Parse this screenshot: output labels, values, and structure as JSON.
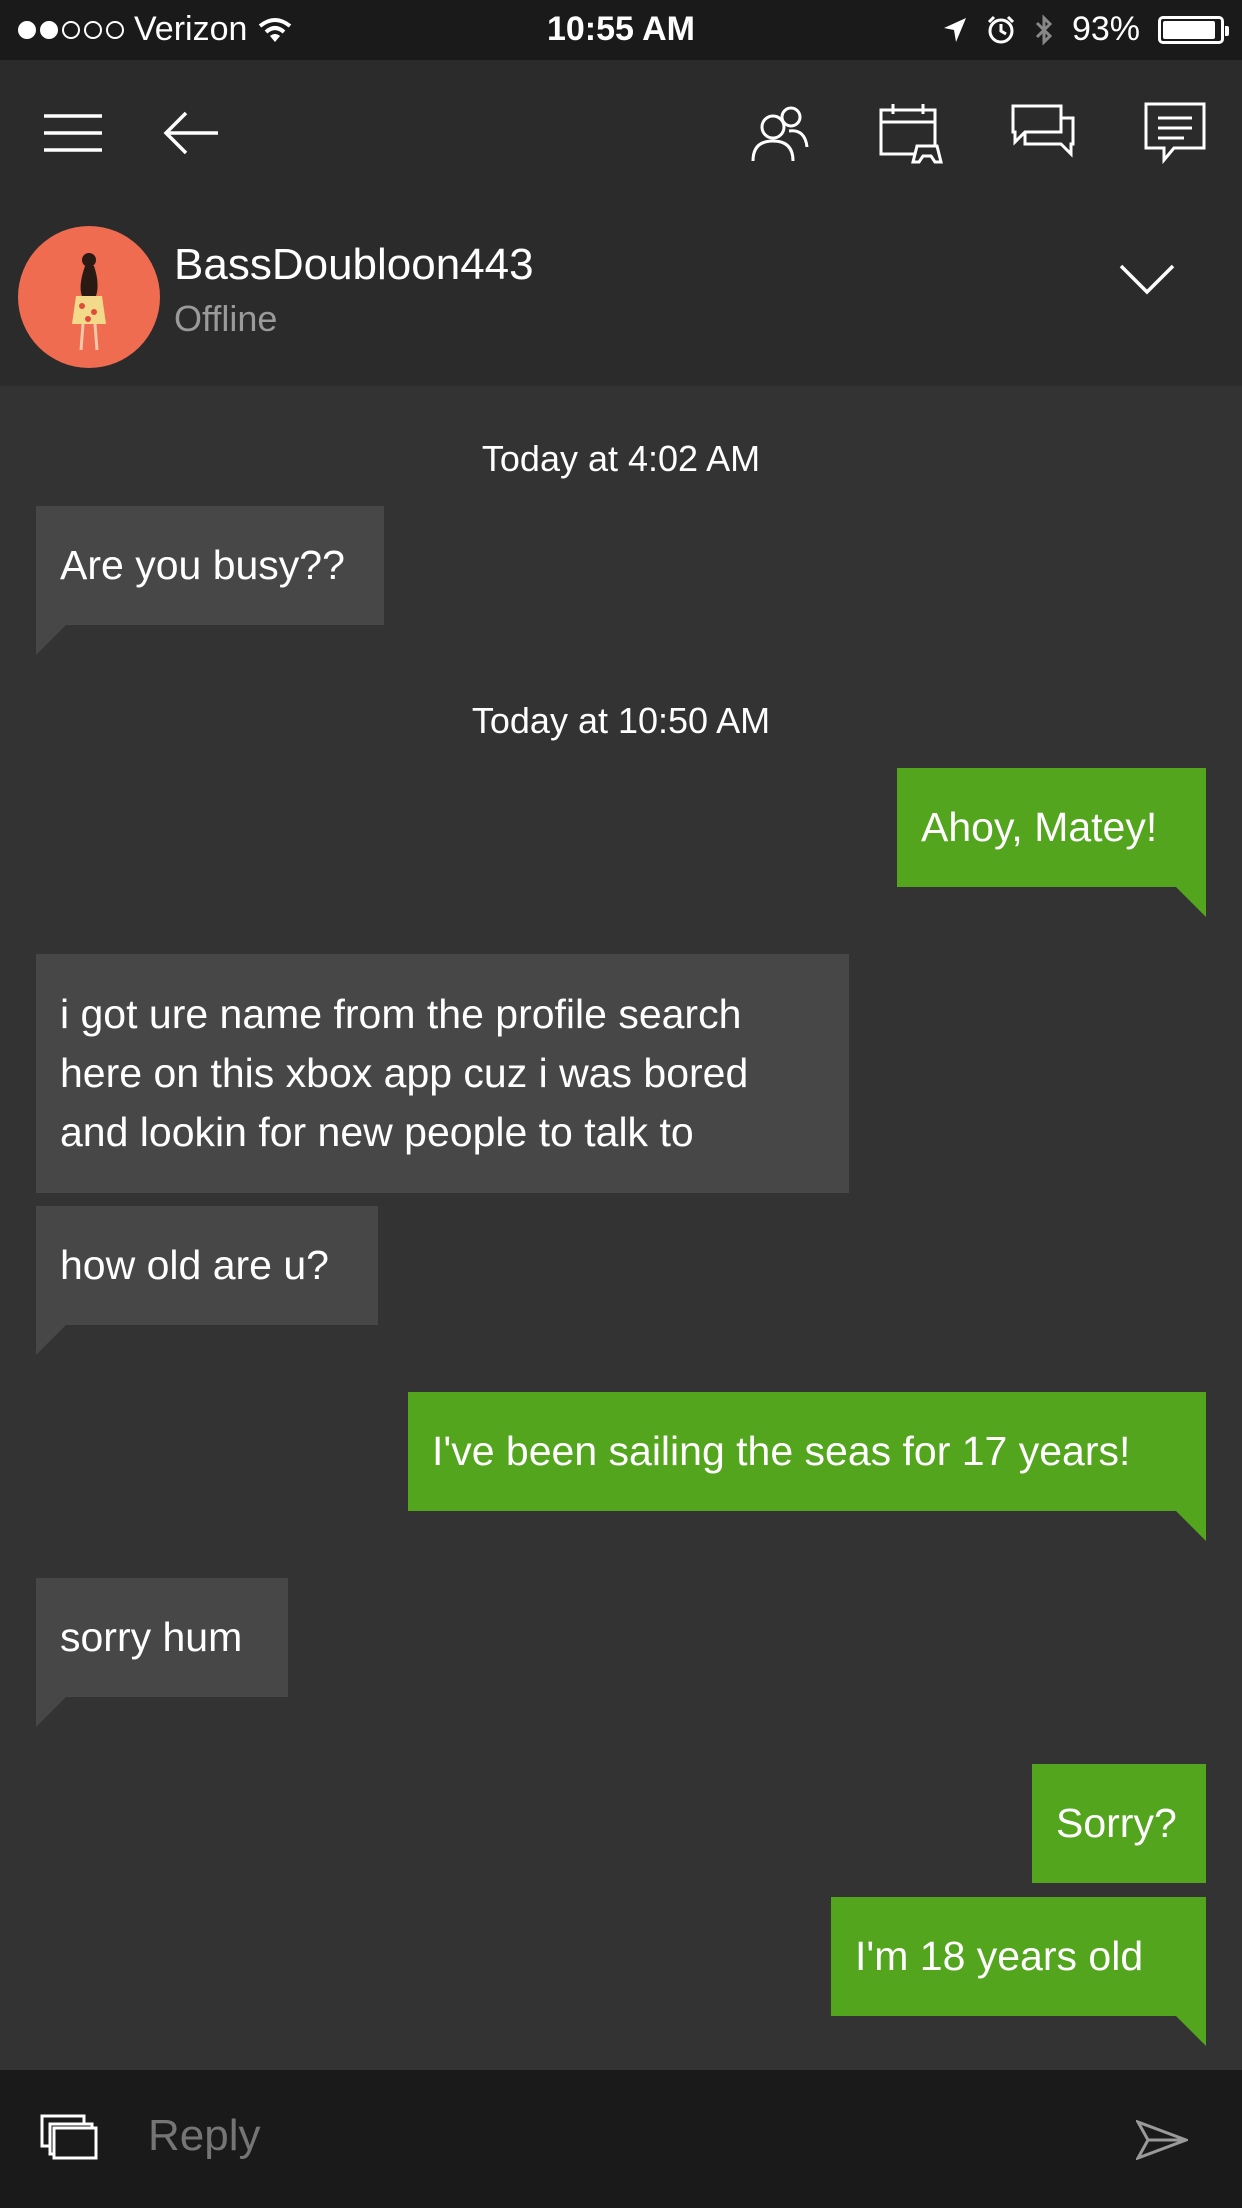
{
  "status_bar": {
    "carrier": "Verizon",
    "signal_bars_filled": 2,
    "signal_bars_total": 5,
    "time": "10:55 AM",
    "battery_text": "93%",
    "battery_level": 0.93
  },
  "toolbar": {
    "icons": [
      "menu-icon",
      "back-arrow-icon",
      "friends-icon",
      "calendar-controller-icon",
      "conversations-icon",
      "messages-icon"
    ]
  },
  "profile": {
    "gamertag": "BassDoubloon443",
    "presence": "Offline",
    "avatar_color": "#ef6c50"
  },
  "messages": [
    {
      "type": "timestamp",
      "text": "Today at 4:02 AM"
    },
    {
      "type": "incoming",
      "text": "Are you busy??"
    },
    {
      "type": "timestamp",
      "text": "Today at 10:50 AM"
    },
    {
      "type": "outgoing",
      "text": "Ahoy, Matey!"
    },
    {
      "type": "incoming",
      "lines": [
        "i got ure name from the profile search",
        "here on this xbox app cuz i was bored",
        "and lookin for new people to talk to"
      ]
    },
    {
      "type": "incoming",
      "text": "how old are u?"
    },
    {
      "type": "outgoing",
      "text": "I've been sailing the seas for 17 years!"
    },
    {
      "type": "incoming",
      "text": "sorry hum"
    },
    {
      "type": "outgoing",
      "text": "Sorry?"
    },
    {
      "type": "outgoing",
      "text": "I'm 18 years old"
    }
  ],
  "composer": {
    "placeholder": "Reply"
  },
  "colors": {
    "background": "#333333",
    "header": "#2b2b2b",
    "incoming_bubble": "#474747",
    "outgoing_bubble": "#52a51c",
    "status_bar": "#1a1a1a"
  }
}
